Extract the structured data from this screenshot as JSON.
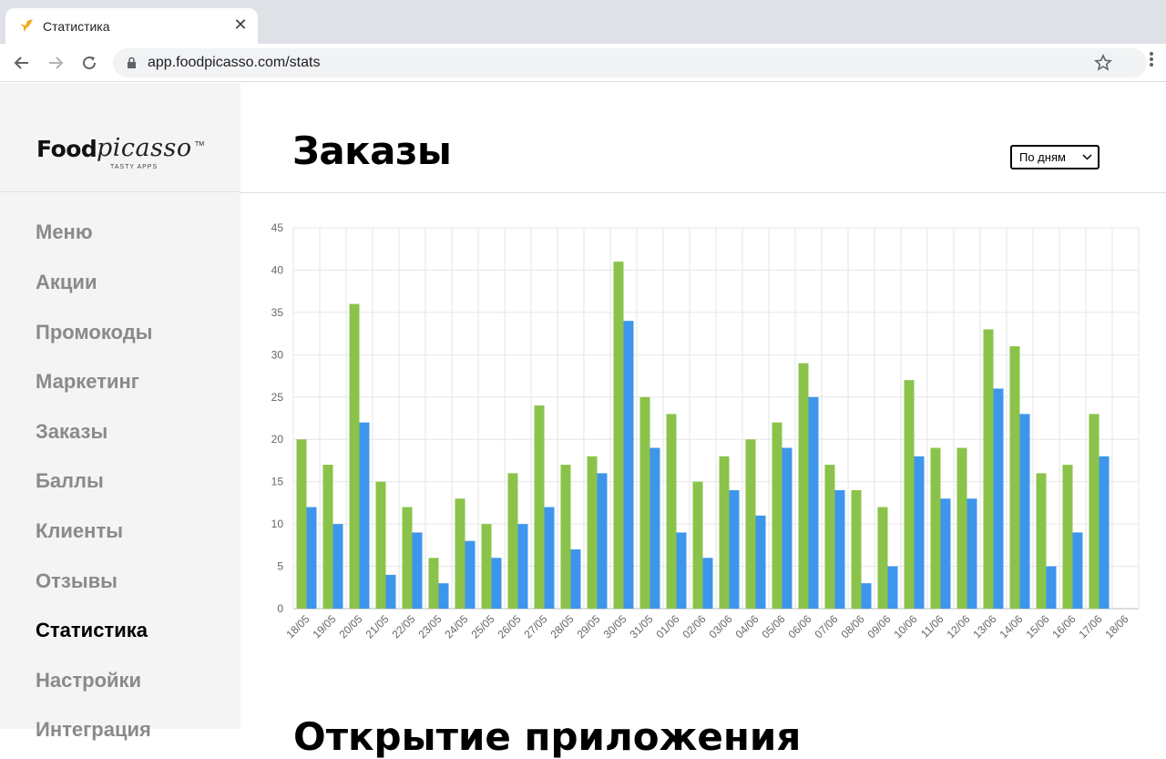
{
  "browser": {
    "tab_title": "Статистика",
    "url": "app.foodpicasso.com/stats"
  },
  "logo": {
    "food": "Food",
    "picasso": "picasso",
    "tm": "TM",
    "tagline": "TASTY APPS"
  },
  "sidebar": {
    "items": [
      {
        "label": "Меню",
        "active": false
      },
      {
        "label": "Акции",
        "active": false
      },
      {
        "label": "Промокоды",
        "active": false
      },
      {
        "label": "Маркетинг",
        "active": false
      },
      {
        "label": "Заказы",
        "active": false
      },
      {
        "label": "Баллы",
        "active": false
      },
      {
        "label": "Клиенты",
        "active": false
      },
      {
        "label": "Отзывы",
        "active": false
      },
      {
        "label": "Статистика",
        "active": true
      },
      {
        "label": "Настройки",
        "active": false
      },
      {
        "label": "Интеграция",
        "active": false
      }
    ]
  },
  "header": {
    "title": "Заказы",
    "period_select": "По дням"
  },
  "section2": {
    "title": "Открытие приложения"
  },
  "colors": {
    "green": "#8bc34a",
    "blue": "#3d96ec",
    "grid": "#e6e6e6"
  },
  "chart_data": {
    "type": "bar",
    "categories": [
      "18/05",
      "19/05",
      "20/05",
      "21/05",
      "22/05",
      "23/05",
      "24/05",
      "25/05",
      "26/05",
      "27/05",
      "28/05",
      "29/05",
      "30/05",
      "31/05",
      "01/06",
      "02/06",
      "03/06",
      "04/06",
      "05/06",
      "06/06",
      "07/06",
      "08/06",
      "09/06",
      "10/06",
      "11/06",
      "12/06",
      "13/06",
      "14/06",
      "15/06",
      "16/06",
      "17/06",
      "18/06"
    ],
    "series": [
      {
        "values": [
          20,
          17,
          36,
          15,
          12,
          6,
          13,
          10,
          16,
          24,
          17,
          18,
          41,
          25,
          23,
          15,
          18,
          20,
          22,
          29,
          17,
          14,
          12,
          27,
          19,
          19,
          33,
          31,
          16,
          17,
          23,
          null
        ]
      },
      {
        "values": [
          12,
          10,
          22,
          4,
          9,
          3,
          8,
          6,
          10,
          12,
          7,
          16,
          34,
          19,
          9,
          6,
          14,
          11,
          19,
          25,
          14,
          3,
          5,
          18,
          13,
          13,
          26,
          23,
          5,
          9,
          18,
          null
        ]
      }
    ],
    "ylim": [
      0,
      45
    ],
    "yticks": [
      0,
      5,
      10,
      15,
      20,
      25,
      30,
      35,
      40,
      45
    ],
    "grid": true,
    "legend": "none"
  }
}
